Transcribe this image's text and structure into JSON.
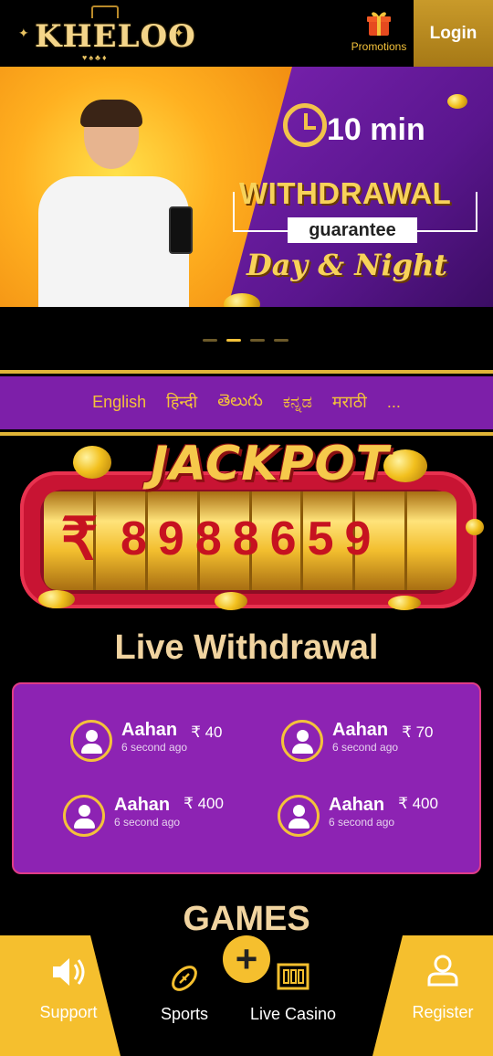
{
  "header": {
    "logo_text": "KHELOO",
    "promotions_label": "Promotions",
    "login_label": "Login"
  },
  "banner": {
    "clock_text": "10 min",
    "withdrawal_text": "WITHDRAWAL",
    "guarantee_text": "guarantee",
    "day_night_text": "Day & Night",
    "slide_count": 4,
    "active_slide": 1
  },
  "languages": [
    "English",
    "हिन्दी",
    "తెలుగు",
    "ಕನ್ನಡ",
    "मराठी",
    "..."
  ],
  "jackpot": {
    "title": "JACKPOT",
    "currency": "₹",
    "amount": "8988659"
  },
  "live_withdrawal": {
    "title": "Live Withdrawal",
    "entries": [
      {
        "name": "Aahan",
        "time": "6 second ago",
        "amount": "₹ 40"
      },
      {
        "name": "Aahan",
        "time": "6 second ago",
        "amount": "₹ 70"
      },
      {
        "name": "Aahan",
        "time": "6 second ago",
        "amount": "₹ 400"
      },
      {
        "name": "Aahan",
        "time": "6 second ago",
        "amount": "₹ 400"
      }
    ]
  },
  "games": {
    "title": "GAMES"
  },
  "bottom_nav": {
    "support_label": "Support",
    "sports_label": "Sports",
    "live_casino_label": "Live Casino",
    "register_label": "Register",
    "plus_symbol": "+"
  },
  "colors": {
    "accent_gold": "#f5bf2e",
    "purple": "#8d23b3",
    "jackpot_red": "#c81433"
  }
}
